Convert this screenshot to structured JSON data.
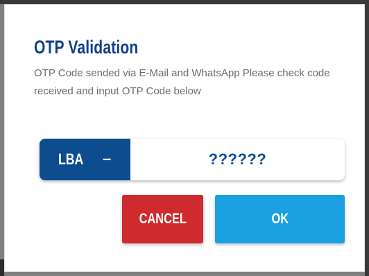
{
  "dialog": {
    "title": "OTP Validation",
    "description": "OTP Code sended via E-Mail and WhatsApp Please check code received and input OTP Code below"
  },
  "otp": {
    "prefix": "LBA",
    "separator": "–",
    "placeholder": "??????"
  },
  "buttons": {
    "cancel_label": "CANCEL",
    "ok_label": "OK"
  },
  "colors": {
    "title": "#0d3f86",
    "prefix_bg": "#0c4c8f",
    "cancel_bg": "#cf2a2e",
    "ok_bg": "#1ba1e2"
  }
}
